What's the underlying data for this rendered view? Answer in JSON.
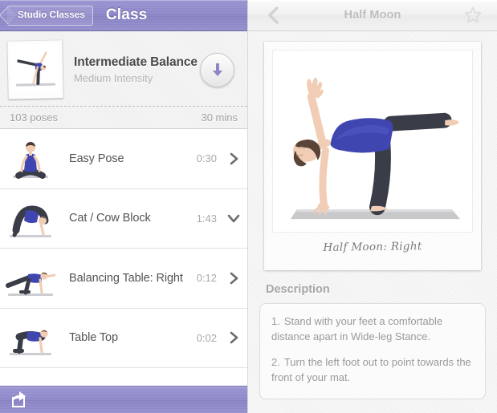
{
  "left": {
    "navbar": {
      "back_label": "Studio Classes",
      "title": "Class",
      "back_icon": "chevron-left-icon"
    },
    "class_card": {
      "title": "Intermediate Balance",
      "subtitle": "Medium Intensity",
      "download_icon": "download-arrow-icon",
      "thumbnail_alt": "half-moon-pose-thumbnail",
      "pose_count": "103 poses",
      "duration": "30 mins"
    },
    "poses": [
      {
        "name": "Easy Pose",
        "time": "0:30",
        "chevron": "chevron-right-icon",
        "prop": null,
        "thumb": "easy-pose-thumbnail"
      },
      {
        "name": "Cat / Cow Block",
        "time": "1:43",
        "chevron": "chevron-down-icon",
        "prop": "block-prop-icon",
        "thumb": "cat-cow-pose-thumbnail"
      },
      {
        "name": "Balancing Table: Right",
        "time": "0:12",
        "chevron": "chevron-right-icon",
        "prop": null,
        "thumb": "balancing-table-pose-thumbnail"
      },
      {
        "name": "Table Top",
        "time": "0:02",
        "chevron": "chevron-right-icon",
        "prop": null,
        "thumb": "table-top-pose-thumbnail"
      }
    ],
    "toolbar": {
      "share_icon": "share-icon"
    }
  },
  "right": {
    "navbar": {
      "title": "Half Moon",
      "back_icon": "chevron-left-icon",
      "favorite_icon": "star-outline-icon"
    },
    "photo": {
      "alt": "half-moon-right-pose-photo",
      "caption": "Half Moon: Right"
    },
    "description": {
      "heading": "Description",
      "steps": [
        {
          "num": "1.",
          "text": "Stand with your feet a comfortable distance apart in Wide-leg Stance."
        },
        {
          "num": "2.",
          "text": "Turn the left foot out to point towards the front of your mat."
        }
      ]
    }
  },
  "colors": {
    "accent_purple": "#8e88ca",
    "nav_purple_light": "#9a95d4",
    "arrow_purple": "#8c86c6",
    "text_dark": "#4a4a4a",
    "text_muted": "#a0a0a0",
    "apparel_blue": "#3f46b0",
    "leggings_dark": "#3a3d48",
    "skin": "#f0cdb4",
    "mat_gray": "#c9c9cc"
  }
}
